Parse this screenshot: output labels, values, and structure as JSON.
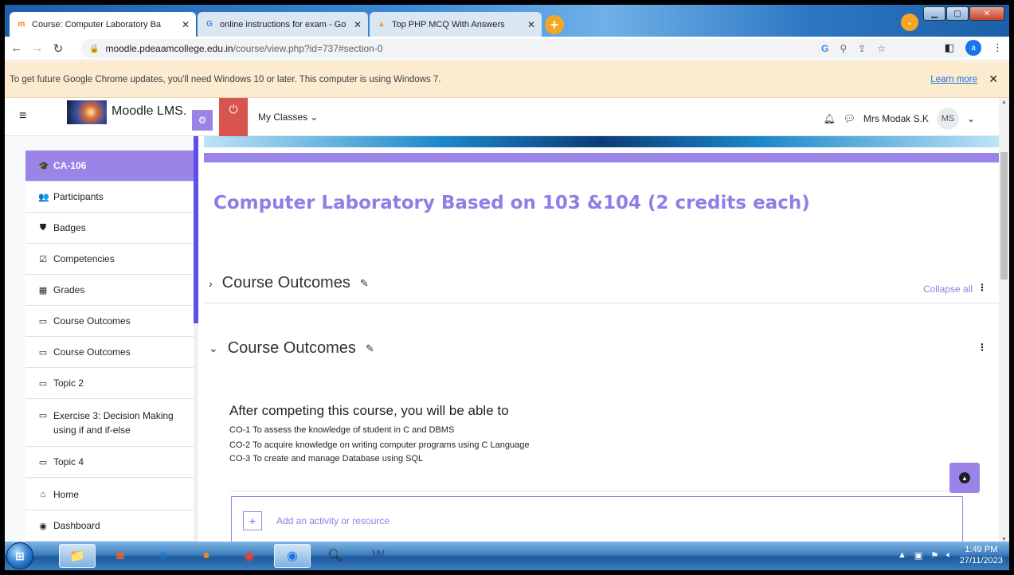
{
  "browser": {
    "tabs": [
      {
        "label": "Course: Computer Laboratory Ba",
        "icon": "moodle-favicon",
        "active": true
      },
      {
        "label": "online instructions for exam - Go",
        "icon": "google-favicon",
        "active": false
      },
      {
        "label": "Top PHP MCQ With Answers",
        "icon": "site-favicon",
        "active": false
      }
    ],
    "new_tab": "+",
    "tab_search": "⌄",
    "url_host": "moodle.pdeaamcollege.edu.in",
    "url_path": "/course/view.php?id=737#section-0",
    "profile_initial": "a"
  },
  "infobar": {
    "message": "To get future Google Chrome updates, you'll need Windows 10 or later. This computer is using Windows 7.",
    "learn_more": "Learn more",
    "close": "✕"
  },
  "navbar": {
    "site_name": "Moodle LMS.",
    "my_classes": "My Classes ⌄",
    "user_name": "Mrs Modak S.K",
    "avatar_initials": "MS",
    "user_menu_caret": "⌄"
  },
  "sidebar": {
    "items": [
      {
        "label": "CA-106",
        "icon": "🎓",
        "active": true
      },
      {
        "label": "Participants",
        "icon": "👥"
      },
      {
        "label": "Badges",
        "icon": "⛊"
      },
      {
        "label": "Competencies",
        "icon": "☑"
      },
      {
        "label": "Grades",
        "icon": "▦"
      },
      {
        "label": "Course Outcomes",
        "icon": "▭"
      },
      {
        "label": "Course Outcomes",
        "icon": "▭"
      },
      {
        "label": "Topic 2",
        "icon": "▭"
      },
      {
        "label": "Exercise 3: Decision Making using if and if-else",
        "icon": "▭"
      },
      {
        "label": "Topic 4",
        "icon": "▭"
      },
      {
        "label": "Home",
        "icon": "⌂"
      },
      {
        "label": "Dashboard",
        "icon": "◉"
      }
    ]
  },
  "main": {
    "course_title": "Computer Laboratory Based on 103 &104 (2 credits each)",
    "sections": [
      {
        "title": "Course Outcomes",
        "chevron": "›"
      },
      {
        "title": "Course Outcomes",
        "chevron": "⌄"
      }
    ],
    "collapse_all": "Collapse all",
    "summary_heading": "After competing this course, you will be able to",
    "summary_lines": [
      "CO-1 To assess the knowledge of student in C and DBMS",
      "CO-2 To acquire knowledge on writing computer programs using C Language",
      "CO-3 To create and manage Database using SQL"
    ],
    "add_activity": "Add an activity or resource"
  },
  "taskbar": {
    "time": "1:49 PM",
    "date": "27/11/2023"
  },
  "colors": {
    "accent": "#9a84e8",
    "title": "#8f7ee6",
    "power": "#d9534f",
    "infobar": "#fcebcf"
  }
}
